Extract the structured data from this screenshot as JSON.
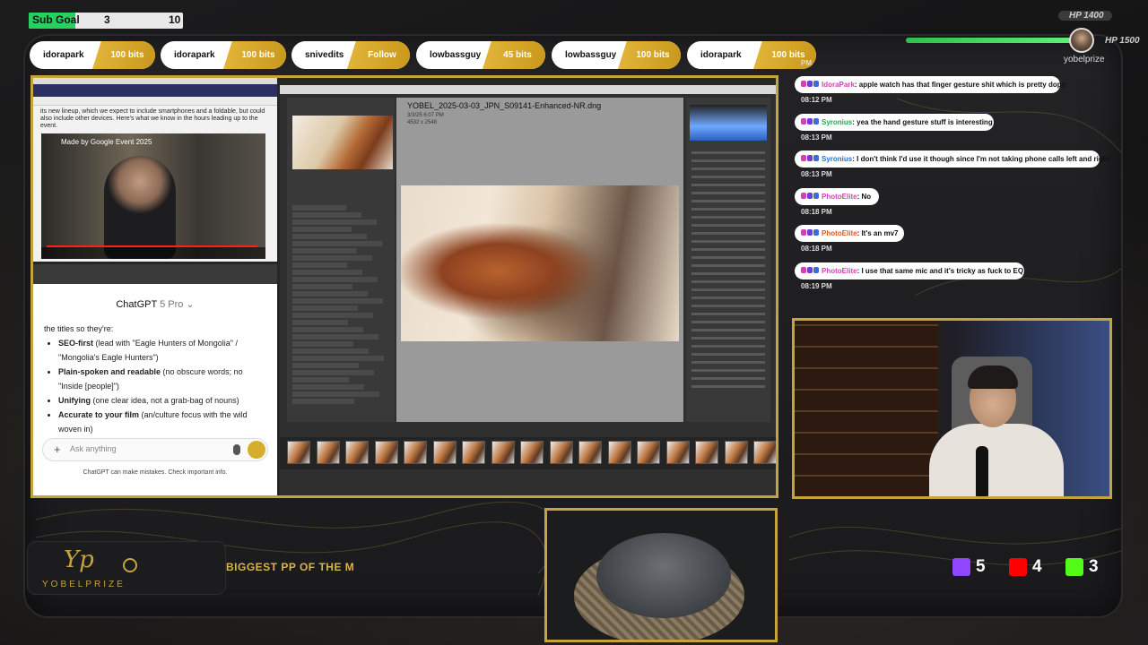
{
  "sub_goal": {
    "label": "Sub Goal",
    "current": "3",
    "target": "10",
    "progress": 0.3
  },
  "hp": {
    "top_label": "HP 1400",
    "label": "HP 1500",
    "level": 0.97,
    "user": "yobelprize"
  },
  "bits": [
    {
      "user": "idorapark",
      "amount": "100 bits"
    },
    {
      "user": "idorapark",
      "amount": "100 bits"
    },
    {
      "user": "snivedits",
      "amount": "Follow"
    },
    {
      "user": "lowbassguy",
      "amount": "45 bits"
    },
    {
      "user": "lowbassguy",
      "amount": "100 bits"
    },
    {
      "user": "idorapark",
      "amount": "100 bits"
    }
  ],
  "browser": {
    "article_text": "its new lineup, which we expect to include smartphones and a foldable, but could also include other devices. Here's what we know in the hours leading up to the event.",
    "video_title": "Made by Google Event 2025"
  },
  "chatgpt": {
    "model": "ChatGPT",
    "model_suffix": "5 Pro",
    "intro": "the titles so they're:",
    "bullets": [
      {
        "bold": "SEO-first",
        "text": " (lead with \"Eagle Hunters of Mongolia\" / \"Mongolia's Eagle Hunters\")"
      },
      {
        "bold": "Plain-spoken and readable",
        "text": " (no obscure words; no \"Inside [people]\")"
      },
      {
        "bold": "Unifying",
        "text": " (one clear idea, not a grab-bag of nouns)"
      },
      {
        "bold": "Accurate to your film",
        "text": " (an/culture focus with the wild woven in)"
      }
    ],
    "input_placeholder": "Ask anything",
    "disclaimer": "ChatGPT can make mistakes. Check important info."
  },
  "lightroom": {
    "filename": "YOBEL_2025-03-03_JPN_S09141-Enhanced-NR.dng",
    "meta_1": "3/3/25 6:07 PM",
    "meta_2": "4532 x 2548"
  },
  "chat": {
    "top_time": "PM",
    "messages": [
      {
        "user": "IdoraPark",
        "color": "#d63fb4",
        "text": ": apple watch has that finger gesture shit which is pretty dope",
        "time": "08:12 PM"
      },
      {
        "user": "Syronius",
        "color": "#2aa44a",
        "text": ": yea the hand gesture stuff is interesting",
        "time": "08:13 PM"
      },
      {
        "user": "Syronius",
        "color": "#2a6fd1",
        "text": ": I don't think I'd use it though since I'm not taking phone calls left and right",
        "time": "08:13 PM"
      },
      {
        "user": "PhotoElite",
        "color": "#d63fb4",
        "text": ": No",
        "time": "08:18 PM"
      },
      {
        "user": "PhotoElite",
        "color": "#e05a1f",
        "text": ": It's an mv7",
        "time": "08:18 PM"
      },
      {
        "user": "PhotoElite",
        "color": "#d63fb4",
        "text": ": I use that same mic and it's tricky as fuck to EQ.",
        "time": "08:19 PM"
      }
    ]
  },
  "branding": {
    "mark": "Yp",
    "name": "YOBELPRIZE",
    "ticker": "BIGGEST PP OF THE MO"
  },
  "socials": [
    {
      "icon": "twitch-icon",
      "color": "#9146ff",
      "count": "5"
    },
    {
      "icon": "youtube-icon",
      "color": "#ff0000",
      "count": "4"
    },
    {
      "icon": "kick-icon",
      "color": "#53fc18",
      "count": "3"
    }
  ],
  "colors": {
    "accent_gold": "#c6a43c",
    "goal_green": "#28d15f"
  }
}
